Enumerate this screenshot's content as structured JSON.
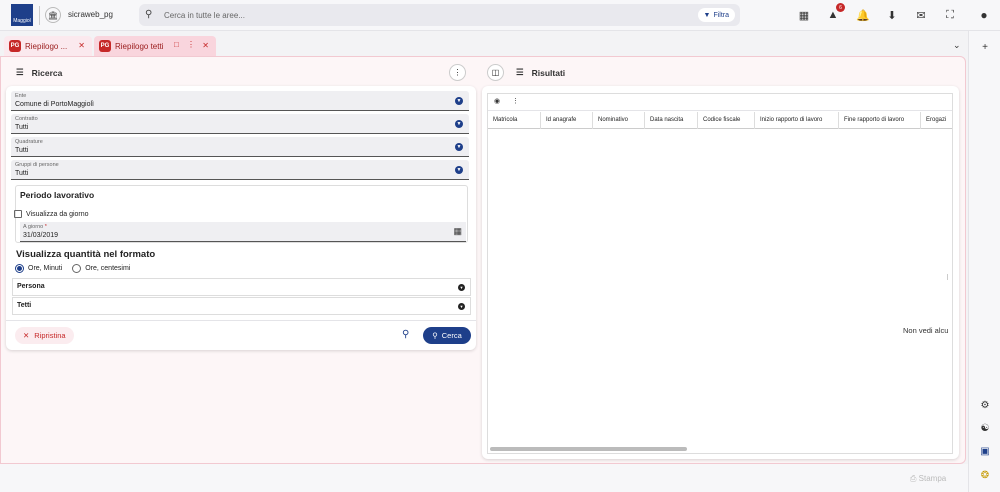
{
  "app": {
    "logo_text": "Maggiol",
    "title": "sicraweb_pg"
  },
  "search": {
    "placeholder": "Cerca in tutte le aree...",
    "filter_label": "Filtra"
  },
  "header_icons": [
    "dashboard-icon",
    "alert-icon",
    "bell-icon",
    "download-icon",
    "mail-icon",
    "fullscreen-icon"
  ],
  "alert_count": "6",
  "tabs": [
    {
      "label": "Riepilogo ...",
      "icon": "PG",
      "active": false
    },
    {
      "label": "Riepilogo tetti",
      "icon": "PG",
      "active": true
    }
  ],
  "ricerca": {
    "title": "Ricerca",
    "fields": [
      {
        "label": "Ente",
        "value": "Comune di PortoMaggiolì"
      },
      {
        "label": "Contratto",
        "value": "Tutti"
      },
      {
        "label": "Quadrature",
        "value": "Tutti"
      },
      {
        "label": "Gruppi di persone",
        "value": "Tutti"
      }
    ],
    "periodo": {
      "title": "Periodo lavorativo",
      "checkbox_label": "Visualizza da giorno",
      "date_label": "A giorno",
      "date_required": "*",
      "date_value": "31/03/2019"
    },
    "formato": {
      "title": "Visualizza quantità nel formato",
      "options": [
        "Ore, Minuti",
        "Ore, centesimi"
      ],
      "selected": "Ore, Minuti"
    },
    "accordions": [
      "Persona",
      "Tetti"
    ],
    "reset_label": "Ripristina",
    "search_label": "Cerca"
  },
  "risultati": {
    "title": "Risultati",
    "columns": [
      "Matricola",
      "Id anagrafe",
      "Nominativo",
      "Data nascita",
      "Codice fiscale",
      "Inizio rapporto di lavoro",
      "Fine rapporto di lavoro",
      "Erogazi"
    ],
    "empty_message": "Non vedi alcu"
  },
  "footer": {
    "print_label": "Stampa"
  },
  "colors": {
    "primary": "#1e3f8a",
    "accent_red": "#c62828",
    "tab_active_bg": "#f9d5dd"
  }
}
